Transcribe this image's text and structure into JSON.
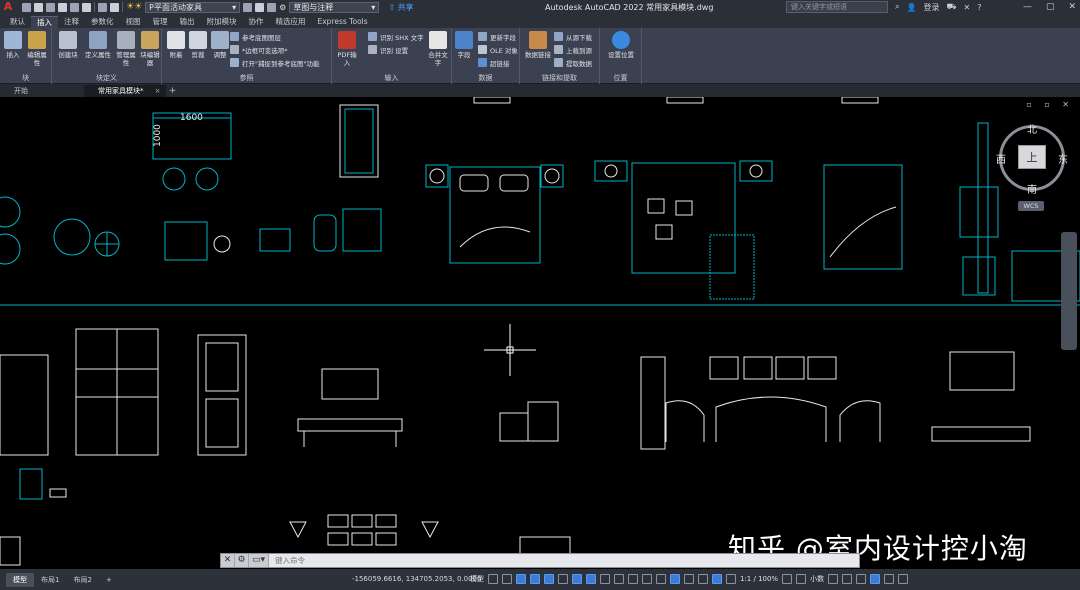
{
  "titlebar": {
    "app_title": "Autodesk AutoCAD 2022    常用家具模块.dwg",
    "workspace": "P平面活动家具",
    "layer": "草图与注释",
    "share": "共享",
    "search_placeholder": "键入关键字或短语",
    "login": "登录"
  },
  "ribbon_tabs": [
    "默认",
    "插入",
    "注释",
    "参数化",
    "视图",
    "管理",
    "输出",
    "附加模块",
    "协作",
    "精选应用",
    "Express Tools"
  ],
  "ribbon_active_tab": "插入",
  "ribbon": {
    "block": {
      "label": "块",
      "insert": "插入",
      "edit_attr": "编辑属性"
    },
    "block_def": {
      "label": "块定义",
      "create": "创建块",
      "define_attr": "定义属性",
      "manage_attr": "管理属性",
      "block_editor": "块编辑器"
    },
    "reference": {
      "label": "参照",
      "attach": "附着",
      "clip": "剪裁",
      "adjust": "调整",
      "underlay_layers": "参考底图图层",
      "frames_vary": "*边框可变选项*",
      "snap_ref": "打开\"捕捉到参考底图\"功能"
    },
    "import": {
      "label": "输入",
      "pdf": "PDF输入",
      "shx": "识别 SHX 文字",
      "recognize_settings": "识别 设置",
      "combine_text": "合并文字"
    },
    "data": {
      "label": "数据",
      "field": "字段",
      "update_fields": "更新字段",
      "ole": "OLE 对象",
      "hyperlink": "超链接"
    },
    "linking": {
      "label": "链接和提取",
      "data_link": "数据链接",
      "download": "从源下载",
      "upload": "上载到源",
      "extract": "提取数据"
    },
    "location": {
      "label": "位置",
      "set_location": "设置位置"
    }
  },
  "file_tabs": [
    "开始",
    "常用家具模块*"
  ],
  "canvas": {
    "dim_width": "1600",
    "dim_height": "1000",
    "viewcube": {
      "north": "北",
      "south": "南",
      "east": "东",
      "west": "西",
      "top": "上",
      "wcs": "WCS"
    }
  },
  "command": {
    "placeholder": "键入命令"
  },
  "watermark": "知乎 @室内设计控小淘",
  "statusbar": {
    "layouts": [
      "模型",
      "布局1",
      "布局2"
    ],
    "coords": "-156059.6616, 134705.2053, 0.0000",
    "model_label": "模型",
    "scale": "1:1 / 100%",
    "units": "小数"
  },
  "colors": {
    "cyan": "#00b5c8",
    "white": "#e8e8e8",
    "accent": "#3c7bd6"
  }
}
